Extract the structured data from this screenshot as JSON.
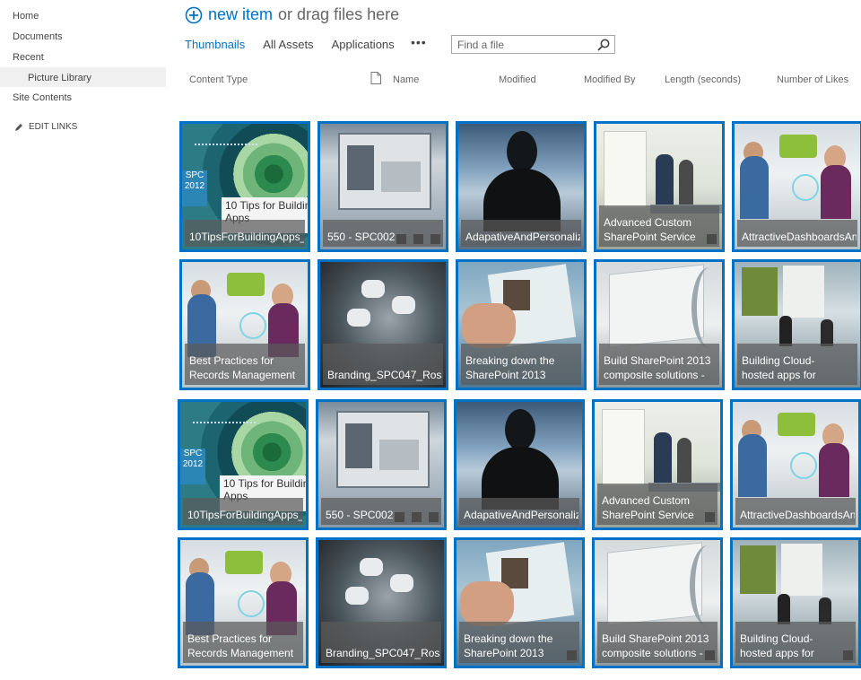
{
  "nav": {
    "home": "Home",
    "documents": "Documents",
    "recent": "Recent",
    "picture_library": "Picture Library",
    "site_contents": "Site Contents",
    "edit_links": "EDIT LINKS"
  },
  "header": {
    "new_item": "new item",
    "drag_text": "or drag files here"
  },
  "views": {
    "thumbnails": "Thumbnails",
    "all_assets": "All Assets",
    "applications": "Applications",
    "more": "•••"
  },
  "search": {
    "placeholder": "Find a file"
  },
  "columns": {
    "content_type": "Content Type",
    "name": "Name",
    "modified": "Modified",
    "modified_by": "Modified By",
    "length": "Length (seconds)",
    "likes": "Number of Likes"
  },
  "tiles": {
    "r0c0": "10TipsForBuildingApps_",
    "r0c1": "550 - SPC002",
    "r0c2": "AdapativeAndPersonaliz",
    "r0c3": "Advanced Custom\nSharePoint Service",
    "r0c4": "AttractiveDashboardsAn",
    "r1c0": "Best Practices for\nRecords Management",
    "r1c1": "Branding_SPC047_Ross",
    "r1c2": "Breaking down the\nSharePoint 2013",
    "r1c3": "Build SharePoint 2013\ncomposite solutions -",
    "r1c4": "Building Cloud-\nhosted apps for",
    "r2c0": "10TipsForBuildingApps_",
    "r2c1": "550 - SPC002",
    "r2c2": "AdapativeAndPersonaliz",
    "r2c3": "Advanced Custom\nSharePoint Service",
    "r2c4": "AttractiveDashboardsAn",
    "r3c0": "Best Practices for\nRecords Management",
    "r3c1": "Branding_SPC047_Ross",
    "r3c2": "Breaking down the\nSharePoint 2013",
    "r3c3": "Build SharePoint 2013\ncomposite solutions -",
    "r3c4": "Building Cloud-\nhosted apps for"
  },
  "art_text": {
    "spc_badge": "SPC\n2012",
    "tips_title": "10 Tips for Buildin\nApps"
  },
  "icons": {
    "plus": "plus-circle-icon",
    "search": "magnifier-icon",
    "edit": "pencil-icon",
    "document": "document-icon"
  },
  "colors": {
    "accent": "#0072c6",
    "tile_border": "#0072c6"
  }
}
